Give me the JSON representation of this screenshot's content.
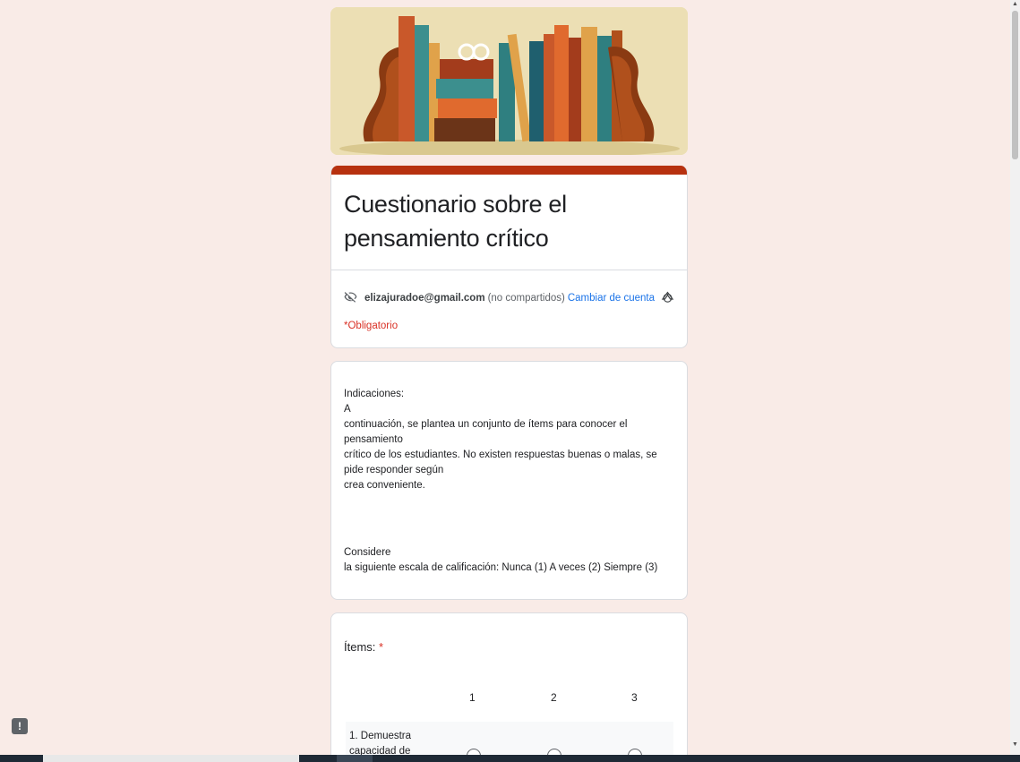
{
  "form": {
    "title": "Cuestionario sobre el pensamiento crítico",
    "account": {
      "email": "elizajuradoe@gmail.com",
      "not_shared": "(no compartidos)",
      "switch_link": "Cambiar de cuenta"
    },
    "required_note": "*Obligatorio"
  },
  "instructions": {
    "heading": "Indicaciones:",
    "line1": "A",
    "line2": "continuación, se plantea un conjunto de ítems para conocer el pensamiento",
    "line3": "crítico de los estudiantes. No existen respuestas buenas o malas, se pide responder según",
    "line4": "crea conveniente.",
    "scale_line1": "Considere",
    "scale_line2": "la siguiente escala de calificación:   Nunca (1)   A veces (2)    Siempre (3)"
  },
  "items": {
    "label": "Ítems:",
    "required_star": "*",
    "columns": [
      "1",
      "2",
      "3"
    ],
    "rows": [
      {
        "line1": "1. Demuestra",
        "line2": "capacidad de pensar"
      }
    ]
  },
  "icons": {
    "visibility": "eye-off-icon",
    "cloud": "cloud-saved-icon",
    "report": "report-icon"
  },
  "colors": {
    "page_bg": "#f9ebe7",
    "accent": "#b7310f",
    "link": "#1a73e8",
    "required": "#d93025"
  }
}
